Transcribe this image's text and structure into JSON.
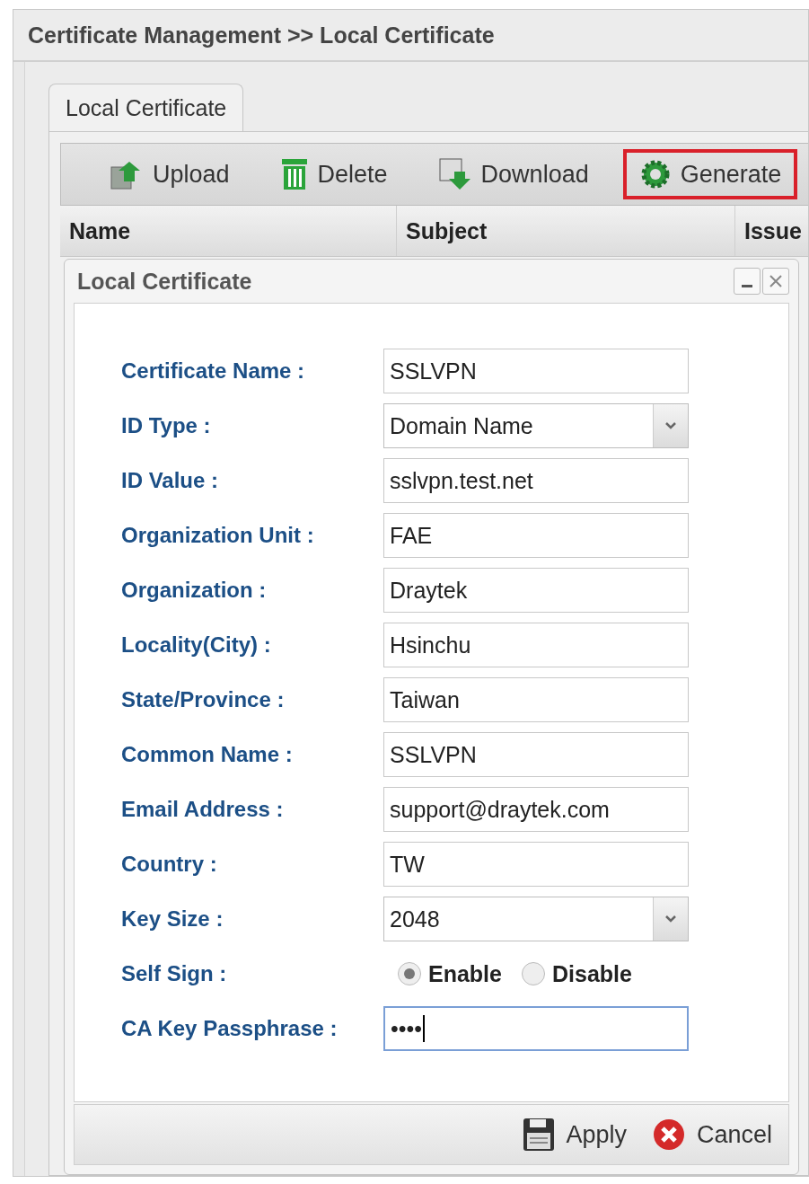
{
  "page_title": "Certificate Management >> Local Certificate",
  "tabs": [
    {
      "label": "Local Certificate",
      "selected": true
    }
  ],
  "toolbar": [
    {
      "kind": "upload",
      "label": "Upload",
      "highlighted": false
    },
    {
      "kind": "delete",
      "label": "Delete",
      "highlighted": false
    },
    {
      "kind": "download",
      "label": "Download",
      "highlighted": false
    },
    {
      "kind": "generate",
      "label": "Generate",
      "highlighted": true
    }
  ],
  "table": {
    "columns": [
      "Name",
      "Subject",
      "Issue"
    ]
  },
  "dialog": {
    "title": "Local Certificate",
    "fields": [
      {
        "kind": "text",
        "label": "Certificate Name :",
        "value": "SSLVPN"
      },
      {
        "kind": "select",
        "label": "ID Type :",
        "value": "Domain Name"
      },
      {
        "kind": "text",
        "label": "ID Value :",
        "value": "sslvpn.test.net"
      },
      {
        "kind": "text",
        "label": "Organization Unit :",
        "value": "FAE"
      },
      {
        "kind": "text",
        "label": "Organization :",
        "value": "Draytek"
      },
      {
        "kind": "text",
        "label": "Locality(City) :",
        "value": "Hsinchu"
      },
      {
        "kind": "text",
        "label": "State/Province :",
        "value": "Taiwan"
      },
      {
        "kind": "text",
        "label": "Common Name :",
        "value": "SSLVPN"
      },
      {
        "kind": "text",
        "label": "Email Address :",
        "value": "support@draytek.com"
      },
      {
        "kind": "text",
        "label": "Country :",
        "value": "TW"
      },
      {
        "kind": "select",
        "label": "Key Size :",
        "value": "2048"
      },
      {
        "kind": "radio",
        "label": "Self Sign :",
        "options": [
          {
            "label": "Enable",
            "selected": true
          },
          {
            "label": "Disable",
            "selected": false
          }
        ]
      },
      {
        "kind": "password",
        "label": "CA Key Passphrase :",
        "value": "••••",
        "focused": true
      }
    ],
    "buttons": [
      {
        "kind": "apply",
        "label": "Apply"
      },
      {
        "kind": "cancel",
        "label": "Cancel"
      }
    ]
  }
}
